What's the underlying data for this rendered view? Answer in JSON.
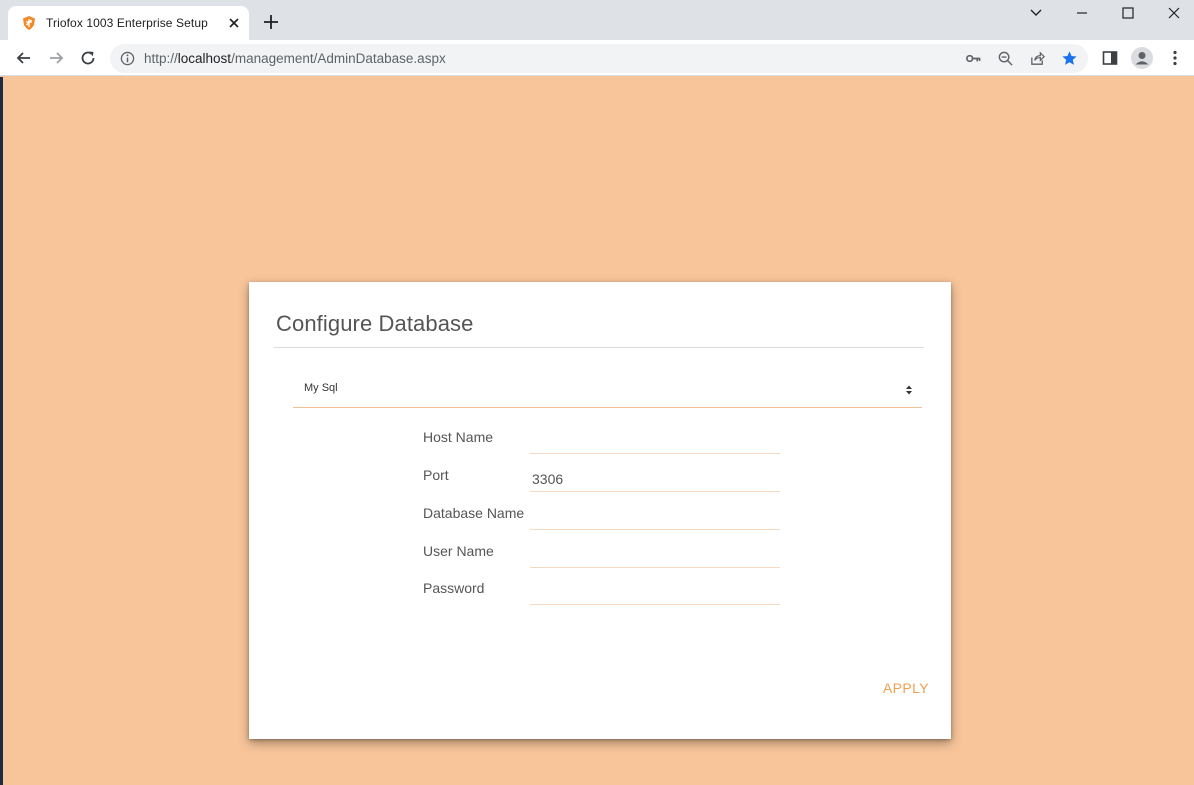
{
  "browser": {
    "tab_title": "Triofox 1003 Enterprise Setup",
    "url_prefix": "http://",
    "url_host": "localhost",
    "url_path": "/management/AdminDatabase.aspx",
    "favicon": "triofox-shield-icon",
    "accent_color": "#1a73e8"
  },
  "page": {
    "background_color": "#f8c59a",
    "accent_color": "#f0a050"
  },
  "card": {
    "title": "Configure Database",
    "db_type": {
      "selected": "My Sql"
    },
    "fields": [
      {
        "label": "Host Name",
        "value": ""
      },
      {
        "label": "Port",
        "value": "3306"
      },
      {
        "label": "Database Name",
        "value": ""
      },
      {
        "label": "User Name",
        "value": ""
      },
      {
        "label": "Password",
        "value": ""
      }
    ],
    "apply_label": "APPLY"
  }
}
